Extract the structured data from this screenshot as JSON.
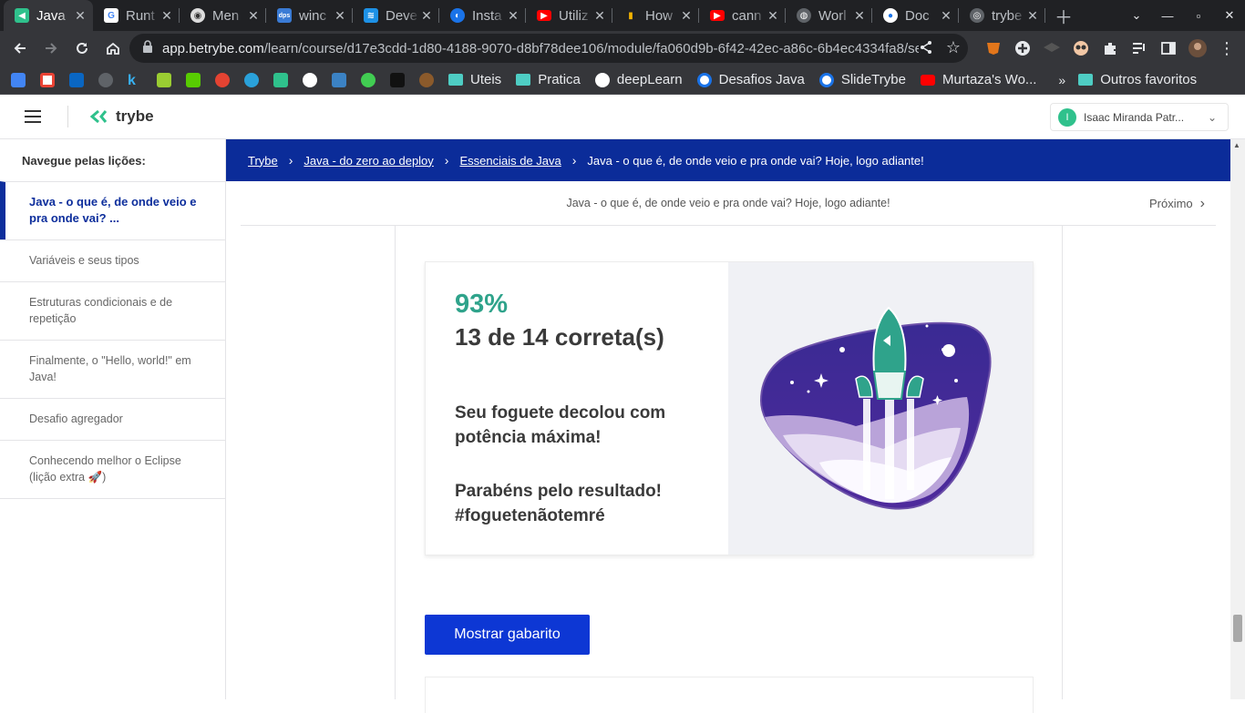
{
  "browser": {
    "tabs": [
      {
        "title": "Java",
        "favicon": "trybe-icon",
        "active": true
      },
      {
        "title": "Runt",
        "favicon": "google-icon"
      },
      {
        "title": "Men",
        "favicon": "dog-icon"
      },
      {
        "title": "winc",
        "favicon": "dps-icon"
      },
      {
        "title": "Deve",
        "favicon": "docker-icon"
      },
      {
        "title": "Insta",
        "favicon": "install-icon"
      },
      {
        "title": "Utiliz",
        "favicon": "youtube-icon"
      },
      {
        "title": "How",
        "favicon": "chart-icon"
      },
      {
        "title": "cann",
        "favicon": "youtube-icon"
      },
      {
        "title": "Worl",
        "favicon": "globe-icon"
      },
      {
        "title": "Doc",
        "favicon": "chrome-icon"
      },
      {
        "title": "trybe",
        "favicon": "github-icon"
      }
    ],
    "url_host": "app.betrybe.com",
    "url_path": "/learn/course/d17e3cdd-1d80-4188-9070-d8bf78dee106/module/fa060d9b-6f42-42ec-a86c-6b4ec4334fa8/sect...",
    "bookmarks": [
      {
        "label": "Uteis",
        "type": "folder"
      },
      {
        "label": "Pratica",
        "type": "folder"
      },
      {
        "label": "deepLearn",
        "type": "wordpress"
      },
      {
        "label": "Desafios Java",
        "type": "chrome"
      },
      {
        "label": "SlideTrybe",
        "type": "chrome"
      },
      {
        "label": "Murtaza's Wo...",
        "type": "youtube"
      }
    ],
    "bookmarks_more": "»",
    "other_bookmarks": "Outros favoritos"
  },
  "header": {
    "logo": "trybe",
    "user_initial": "I",
    "user_name": "Isaac Miranda Patr..."
  },
  "sidebar": {
    "title": "Navegue pelas lições:",
    "lessons": [
      {
        "label": "Java - o que é, de onde veio e pra onde vai? ..."
      },
      {
        "label": "Variáveis e seus tipos"
      },
      {
        "label": "Estruturas condicionais e de repetição"
      },
      {
        "label": "Finalmente, o \"Hello, world!\" em Java!"
      },
      {
        "label": "Desafio agregador"
      },
      {
        "label": "Conhecendo melhor o Eclipse (lição extra 🚀)"
      }
    ]
  },
  "breadcrumb": {
    "items": [
      "Trybe",
      "Java - do zero ao deploy",
      "Essenciais de Java"
    ],
    "current": "Java - o que é, de onde veio e pra onde vai? Hoje, logo adiante!"
  },
  "subheader": {
    "title": "Java - o que é, de onde veio e pra onde vai? Hoje, logo adiante!",
    "next_label": "Próximo"
  },
  "result": {
    "percent": "93%",
    "score": "13 de 14 correta(s)",
    "message1": "Seu foguete decolou com potência máxima!",
    "message2": "Parabéns pelo resultado! #foguetenãotemré"
  },
  "actions": {
    "show_answers": "Mostrar gabarito"
  },
  "colors": {
    "brand_blue": "#0b2c99",
    "button_blue": "#0d37d4",
    "accent_green": "#2fa38b"
  }
}
